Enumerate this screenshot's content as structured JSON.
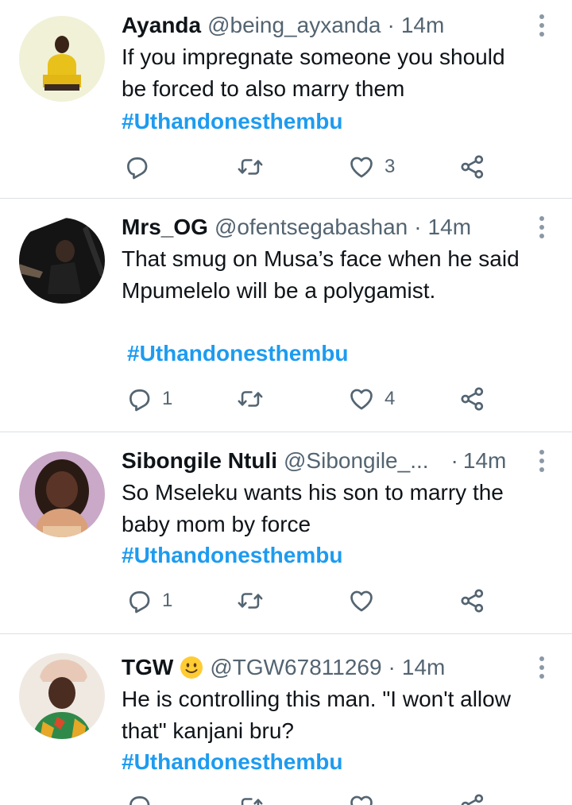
{
  "tweets": [
    {
      "name": "Ayanda",
      "handle": "@being_ayxanda",
      "time": "14m",
      "text_lines": [
        "If you impregnate someone you should",
        "be forced to also marry them"
      ],
      "hashtag": "#Uthandonesthembu",
      "reply_count": "",
      "like_count": "3"
    },
    {
      "name": "Mrs_OG",
      "handle": "@ofentsegabashan",
      "time": "14m",
      "text_lines": [
        "That smug on Musa’s face when he said",
        "Mpumelelo will be a polygamist."
      ],
      "hashtag": "#Uthandonesthembu",
      "reply_count": "1",
      "like_count": "4"
    },
    {
      "name": "Sibongile Ntuli",
      "handle": "@Sibongile_...",
      "time": "14m",
      "text_lines": [
        "So Mseleku wants his son to marry the",
        "baby mom by force"
      ],
      "hashtag": "#Uthandonesthembu",
      "reply_count": "1",
      "like_count": ""
    },
    {
      "name": "TGW",
      "handle": "@TGW67811269",
      "time": "14m",
      "text_lines": [
        "He is controlling this man. \"I won't allow",
        "that\" kanjani bru?"
      ],
      "hashtag": "#Uthandonesthembu",
      "reply_count": "",
      "like_count": ""
    }
  ],
  "separator": "·",
  "icons": {
    "reply": "reply-icon",
    "retweet": "retweet-icon",
    "like": "heart-icon",
    "share": "share-icon",
    "more": "more-vertical-icon",
    "emoji": "smiling-face-emoji"
  },
  "colors": {
    "accent": "#1d9bf0",
    "text": "#0f1419",
    "muted": "#536471",
    "divider": "#dcdfe2"
  }
}
